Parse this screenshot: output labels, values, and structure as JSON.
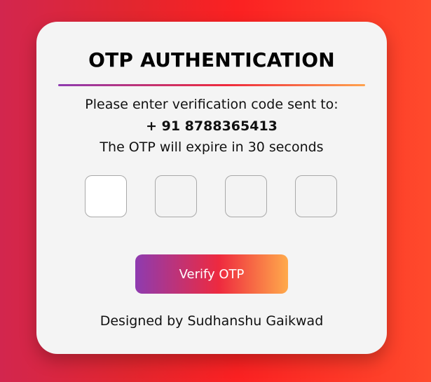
{
  "card": {
    "title": "OTP AUTHENTICATION",
    "instruction": "Please enter verification code sent to:",
    "phone": "+ 91 8788365413",
    "expiry": "The OTP will expire in 30 seconds",
    "otp_inputs": [
      {
        "value": "",
        "placeholder": ""
      },
      {
        "value": "",
        "placeholder": ""
      },
      {
        "value": "",
        "placeholder": ""
      },
      {
        "value": "",
        "placeholder": ""
      }
    ],
    "verify_label": "Verify OTP",
    "footer": "Designed by Sudhanshu Gaikwad"
  },
  "colors": {
    "background_start": "#d2264e",
    "background_end": "#ff4a2c",
    "card_bg": "#f4f4f4",
    "accent_purple": "#8e3bb0",
    "accent_red": "#ef2a3c",
    "accent_orange": "#ffa24d"
  }
}
